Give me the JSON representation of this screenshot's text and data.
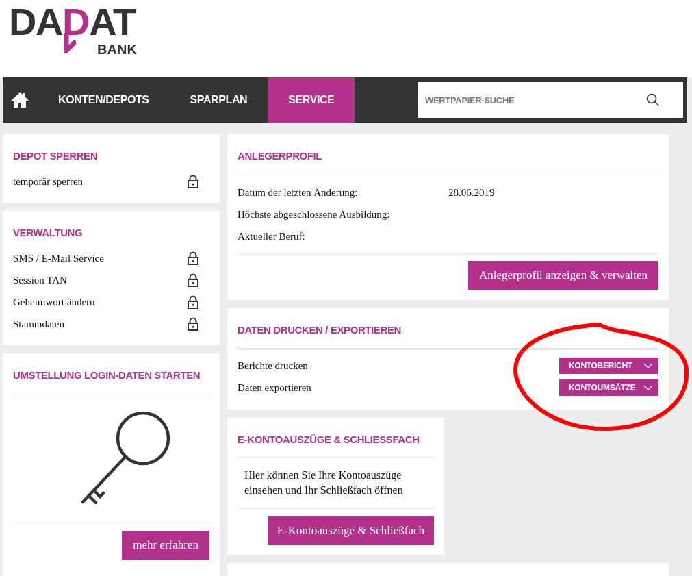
{
  "logo": {
    "left": "DA",
    "mark": "D",
    "right": "AT",
    "sub": "BANK"
  },
  "nav": {
    "items": [
      {
        "label": "KONTEN/DEPOTS",
        "selected": false
      },
      {
        "label": "SPARPLAN",
        "selected": false
      },
      {
        "label": "SERVICE",
        "selected": true
      }
    ],
    "search": {
      "placeholder": "WERTPAPIER-SUCHE"
    }
  },
  "left_column": [
    {
      "kind": "list",
      "title": "DEPOT SPERREN",
      "items": [
        "temporär sperren"
      ]
    },
    {
      "kind": "list",
      "title": "VERWALTUNG",
      "items": [
        "SMS / E-Mail Service",
        "Session TAN",
        "Geheimwort ändern",
        "Stammdaten"
      ]
    },
    {
      "kind": "promo",
      "title": "UMSTELLUNG LOGIN-DATEN STARTEN",
      "button": "mehr erfahren"
    }
  ],
  "right_column": [
    {
      "kind": "profile",
      "title": "ANLEGERPROFIL",
      "rows": [
        {
          "label": "Datum der letzten Änderung:",
          "value": "28.06.2019"
        },
        {
          "label": "Höchste abgeschlossene Ausbildung:"
        },
        {
          "label": "Aktueller Beruf:"
        }
      ],
      "button": "Anlegerprofil anzeigen & verwalten"
    },
    {
      "kind": "export",
      "title": "DATEN DRUCKEN / EXPORTIEREN",
      "rows": [
        {
          "label": "Berichte drucken",
          "dropdown": "KONTOBERICHT"
        },
        {
          "label": "Daten exportieren",
          "dropdown": "KONTOUMSÄTZE"
        }
      ]
    },
    {
      "kind": "text",
      "title": "E-KONTOAUSZÜGE & SCHLIESSFACH",
      "text": "Hier können Sie Ihre Kontoauszüge einsehen und Ihr Schließfach öffnen",
      "button": "E-Kontoauszüge & Schließfach"
    },
    {
      "kind": "blank"
    }
  ]
}
